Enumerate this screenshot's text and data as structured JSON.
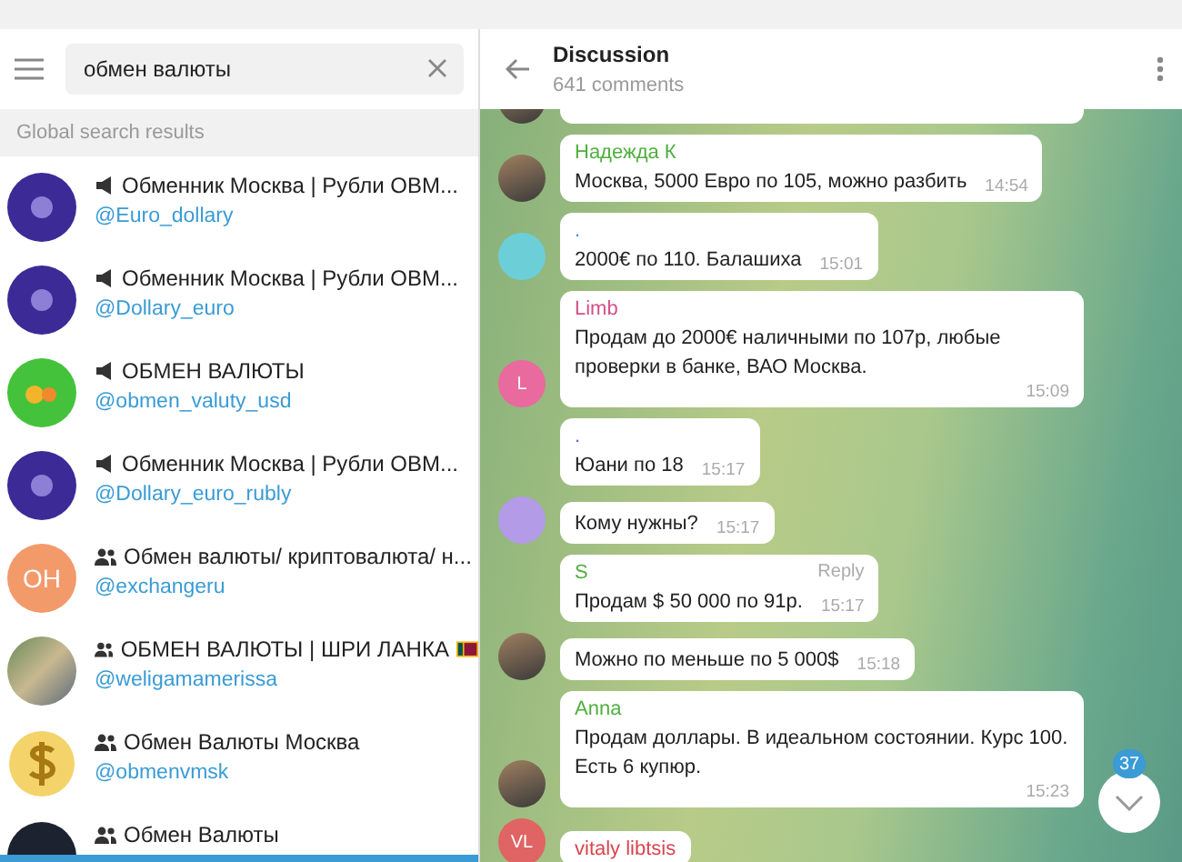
{
  "search": {
    "value": "обмен валюты"
  },
  "results_header": "Global search results",
  "results": [
    {
      "kind": "channel",
      "avatar": {
        "kind": "logo"
      },
      "title": "Обменник Москва | Рубли ОВМ...",
      "username": "@Euro_dollary"
    },
    {
      "kind": "channel",
      "avatar": {
        "kind": "logo"
      },
      "title": "Обменник Москва | Рубли ОВМ...",
      "username": "@Dollary_euro"
    },
    {
      "kind": "channel",
      "avatar": {
        "kind": "badge"
      },
      "title": "ОБМЕН ВАЛЮТЫ",
      "username": "@obmen_valuty_usd"
    },
    {
      "kind": "channel",
      "avatar": {
        "kind": "logo"
      },
      "title": "Обменник Москва | Рубли ОВМ...",
      "username": "@Dollary_euro_rubly"
    },
    {
      "kind": "group",
      "avatar": {
        "kind": "initials",
        "initials": "OH",
        "color": "#f39a6b"
      },
      "title": "Обмен валюты/ криптовалюта/ н...",
      "username": "@exchangeru"
    },
    {
      "kind": "group",
      "avatar": {
        "kind": "photo"
      },
      "title": "ОБМЕН ВАЛЮТЫ | ШРИ ЛАНКА",
      "username": "@weligamamerissa",
      "flag_icon": true
    },
    {
      "kind": "group",
      "avatar": {
        "kind": "dollar"
      },
      "title": "Обмен Валюты Москва",
      "username": "@obmenvmsk"
    },
    {
      "kind": "group",
      "avatar": {
        "kind": "dark"
      },
      "title": "Обмен Валюты"
    }
  ],
  "chat": {
    "title": "Discussion",
    "subtitle": "641 comments"
  },
  "messages": [
    {
      "avatar": {
        "kind": "photo"
      }
    },
    {
      "sender": {
        "name": "Надежда К",
        "color": "#4fae3e"
      },
      "text": "Москва, 5000 Евро по 105, можно разбить",
      "time": "14:54",
      "avatar": {
        "kind": "photo"
      }
    },
    {
      "sender": {
        "name": ".",
        "color": "#3a8fc9"
      },
      "text": "2000€ по 110. Балашиха",
      "time": "15:01",
      "avatar": {
        "kind": "plain",
        "color": "#6ccfd8"
      }
    },
    {
      "sender": {
        "name": "Limb",
        "color": "#d14f8a"
      },
      "text": "Продам до 2000€ наличными по 107р, любые проверки в банке, ВАО Москва.",
      "time": "15:09",
      "avatar": {
        "kind": "initials",
        "initials": "L",
        "color": "#e86a9e"
      }
    },
    {
      "sender": {
        "name": ".",
        "color": "#7a5fc9"
      },
      "text": "Юани по 18",
      "time": "15:17",
      "avatar": {
        "kind": "none"
      }
    },
    {
      "text": "Кому нужны?",
      "time": "15:17",
      "avatar": {
        "kind": "plain",
        "color": "#b39be8"
      }
    },
    {
      "sender": {
        "name": "S",
        "color": "#4fae3e"
      },
      "reply": "Reply",
      "text": "Продам $ 50 000 по 91р.",
      "time": "15:17",
      "avatar": {
        "kind": "none"
      }
    },
    {
      "text": "Можно по меньше по 5 000$",
      "time": "15:18",
      "avatar": {
        "kind": "photo"
      }
    },
    {
      "sender": {
        "name": "Anna",
        "color": "#4fae3e"
      },
      "text": "Продам доллары. В идеальном состоянии. Курс 100. Есть 6 купюр.",
      "time": "15:23",
      "avatar": {
        "kind": "photo"
      }
    },
    {
      "sender": {
        "name": "vitaly libtsis",
        "color": "#d9444f"
      },
      "avatar": {
        "kind": "initials",
        "initials": "VL",
        "color": "#e06464"
      }
    }
  ],
  "unread_badge": "37"
}
